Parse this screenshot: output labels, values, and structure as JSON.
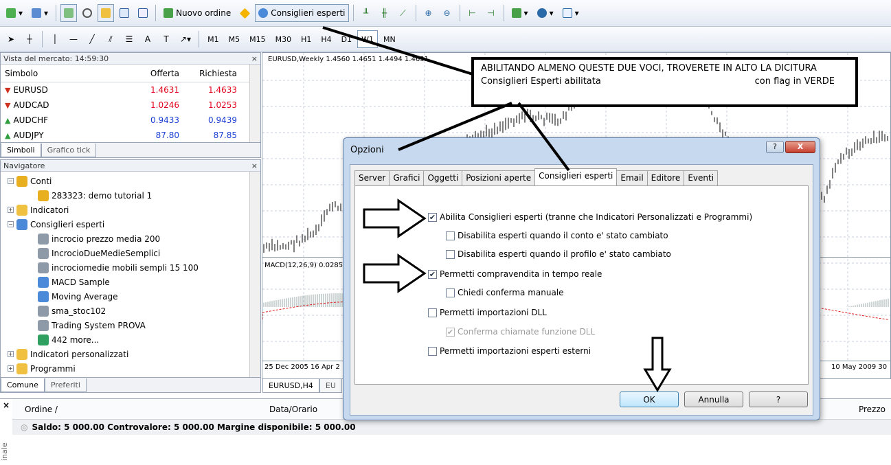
{
  "toolbar1": {
    "new_order_label": "Nuovo ordine",
    "expert_advisors_label": "Consiglieri esperti"
  },
  "toolbar2": {
    "timeframes": [
      "M1",
      "M5",
      "M15",
      "M30",
      "H1",
      "H4",
      "D1",
      "W1",
      "MN"
    ],
    "active_timeframe": "W1"
  },
  "market_watch": {
    "title": "Vista del mercato: 14:59:30",
    "columns": [
      "Simbolo",
      "Offerta",
      "Richiesta"
    ],
    "rows": [
      {
        "symbol": "EURUSD",
        "bid": "1.4631",
        "ask": "1.4633",
        "trend": "down"
      },
      {
        "symbol": "AUDCAD",
        "bid": "1.0246",
        "ask": "1.0253",
        "trend": "down"
      },
      {
        "symbol": "AUDCHF",
        "bid": "0.9433",
        "ask": "0.9439",
        "trend": "up"
      },
      {
        "symbol": "AUDJPY",
        "bid": "87.80",
        "ask": "87.85",
        "trend": "up"
      }
    ],
    "tabs": [
      "Simboli",
      "Grafico tick"
    ]
  },
  "navigator": {
    "title": "Navigatore",
    "items": [
      {
        "label": "Conti",
        "level": 0,
        "expander": "−"
      },
      {
        "label": "283323: demo tutorial 1",
        "level": 1,
        "expander": ""
      },
      {
        "label": "Indicatori",
        "level": 0,
        "expander": "+"
      },
      {
        "label": "Consiglieri esperti",
        "level": 0,
        "expander": "−"
      },
      {
        "label": "incrocio prezzo media 200",
        "level": 1,
        "expander": ""
      },
      {
        "label": "IncrocioDueMedieSemplici",
        "level": 1,
        "expander": ""
      },
      {
        "label": "incrociomedie mobili sempli 15 100",
        "level": 1,
        "expander": ""
      },
      {
        "label": "MACD Sample",
        "level": 1,
        "expander": ""
      },
      {
        "label": "Moving Average",
        "level": 1,
        "expander": ""
      },
      {
        "label": "sma_stoc102",
        "level": 1,
        "expander": ""
      },
      {
        "label": "Trading System PROVA",
        "level": 1,
        "expander": ""
      },
      {
        "label": "442 more...",
        "level": 1,
        "expander": ""
      },
      {
        "label": "Indicatori personalizzati",
        "level": 0,
        "expander": "+"
      },
      {
        "label": "Programmi",
        "level": 0,
        "expander": "+"
      }
    ],
    "tabs": [
      "Comune",
      "Preferiti"
    ]
  },
  "chart": {
    "header": "EURUSD,Weekly  1.4560 1.4651 1.4494 1.4631",
    "macd_header": "MACD(12,26,9) 0.0285",
    "date_left": "25 Dec 2005   16 Apr 2",
    "date_right": "10 May 2009   30",
    "tabs": [
      "EURUSD,H4",
      "EU"
    ]
  },
  "annotation": {
    "line1": "ABILITANDO ALMENO QUESTE DUE VOCI, TROVERETE IN ALTO LA DICITURA",
    "line2a": "Consiglieri Esperti abilitata",
    "line2b": "con flag in VERDE"
  },
  "dialog": {
    "title": "Opzioni",
    "help_glyph": "?",
    "close_glyph": "X",
    "tabs": [
      "Server",
      "Grafici",
      "Oggetti",
      "Posizioni aperte",
      "Consiglieri esperti",
      "Email",
      "Editore",
      "Eventi"
    ],
    "selected_tab": "Consiglieri esperti",
    "options": {
      "enable_experts": "Abilita Consiglieri esperti (tranne che Indicatori Personalizzati e Programmi)",
      "disable_account_change": "Disabilita esperti quando il conto e' stato cambiato",
      "disable_profile_change": "Disabilita esperti quando il profilo e' stato cambiato",
      "allow_live_trading": "Permetti compravendita in tempo reale",
      "ask_manual_confirm": "Chiedi conferma manuale",
      "allow_dll": "Permetti importazioni DLL",
      "confirm_dll_calls": "Conferma chiamate funzione DLL",
      "allow_external_experts": "Permetti importazioni esperti esterni"
    },
    "buttons": {
      "ok": "OK",
      "cancel": "Annulla",
      "help": "?"
    }
  },
  "terminal": {
    "columns": {
      "order": "Ordine  /",
      "datetime": "Data/Orario",
      "price": "Prezzo"
    },
    "balance_line": "Saldo: 5 000.00  Controvalore: 5 000.00  Margine disponibile: 5 000.00",
    "side_label": "inale"
  },
  "colors": {
    "up": "#2e9e3e",
    "down": "#d03020",
    "bid": "#e0001b",
    "ask_up": "#1b3fd4"
  }
}
